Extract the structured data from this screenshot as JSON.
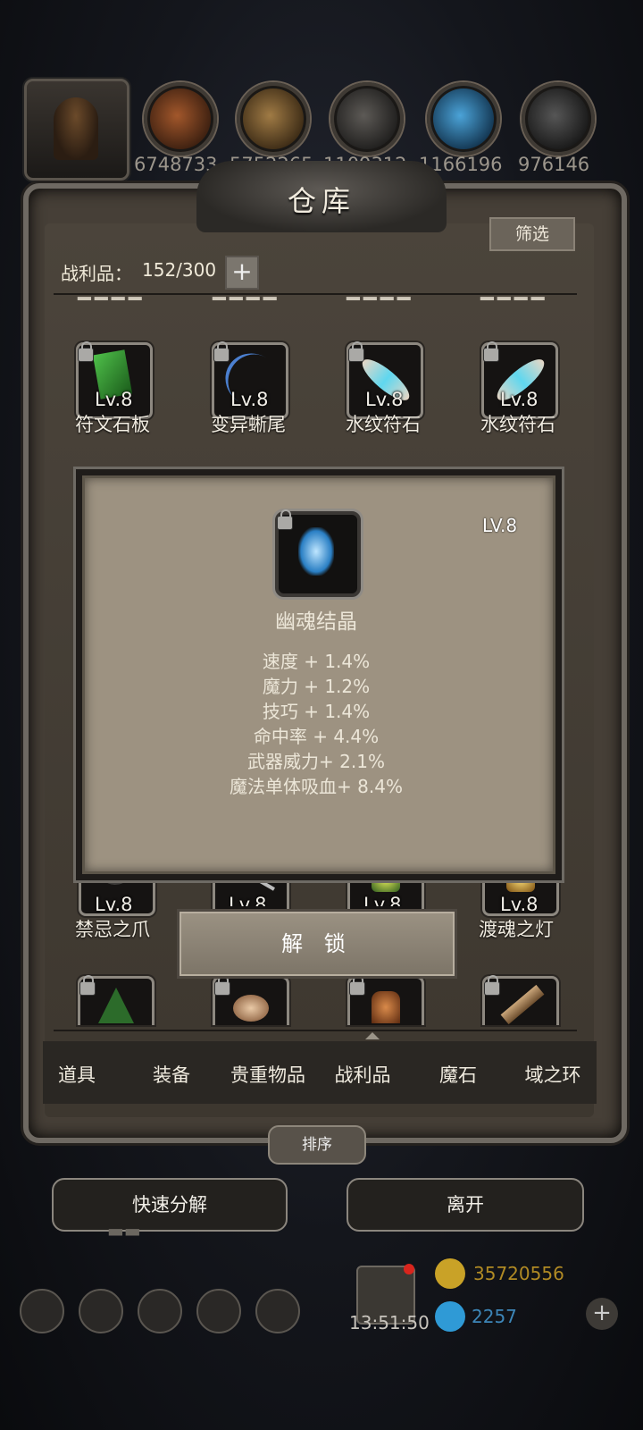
{
  "header": {
    "resources": [
      {
        "icon": "meat-icon",
        "count": "6748733",
        "color": "#8a4a22"
      },
      {
        "icon": "wood-icon",
        "count": "5752265",
        "color": "#8c6a3a"
      },
      {
        "icon": "stone-icon",
        "count": "1109312",
        "color": "#4b4a48"
      },
      {
        "icon": "crystal-icon",
        "count": "1166196",
        "color": "#2f7fb3"
      },
      {
        "icon": "iron-icon",
        "count": "976146",
        "color": "#3c3c3c"
      }
    ]
  },
  "panel": {
    "title": "仓库",
    "filter_label": "筛选",
    "loot_label": "战利品：",
    "loot_count": "152/300",
    "plus_label": "+"
  },
  "items_row1": [
    {
      "lv": "Lv.8",
      "name": "符文石板",
      "icon": "rune-slab-icon",
      "color": "#2c7a2a"
    },
    {
      "lv": "Lv.8",
      "name": "变异蜥尾",
      "icon": "lizard-tail-icon",
      "color": "#1f3f6b"
    },
    {
      "lv": "Lv.8",
      "name": "水纹符石",
      "icon": "water-rune-stone-icon",
      "color": "#4fb0c8"
    },
    {
      "lv": "Lv.8",
      "name": "水纹符石",
      "icon": "water-rune-stone-icon",
      "color": "#4fb0c8"
    }
  ],
  "items_row2": [
    {
      "lv": "Lv.8",
      "name": "禁忌之爪",
      "icon": "claw-icon"
    },
    {
      "lv": "Lv.8",
      "name": "",
      "icon": "blade-icon"
    },
    {
      "lv": "Lv.8",
      "name": "",
      "icon": "lantern-icon"
    },
    {
      "lv": "Lv.8",
      "name": "渡魂之灯",
      "icon": "soul-lamp-icon"
    }
  ],
  "items_row3": [
    {
      "icon": "tree-icon"
    },
    {
      "icon": "horn-icon"
    },
    {
      "icon": "lantern-red-icon"
    },
    {
      "icon": "stick-icon"
    }
  ],
  "popup": {
    "level": "LV.8",
    "item_name": "幽魂结晶",
    "stats": [
      "速度 + 1.4%",
      "魔力 + 1.2%",
      "技巧 + 1.4%",
      "命中率 + 4.4%",
      "武器威力+ 2.1%",
      "魔法单体吸血+ 8.4%"
    ],
    "unlock_label": "解 锁"
  },
  "tabs": [
    "道具",
    "装备",
    "贵重物品",
    "战利品",
    "魔石",
    "域之环"
  ],
  "sort_label": "排序",
  "bottom_buttons": {
    "quick_decompose": "快速分解",
    "leave": "离开"
  },
  "background_ui": {
    "timer": "13:51:50",
    "gold": "35720556",
    "gems": "2257"
  }
}
